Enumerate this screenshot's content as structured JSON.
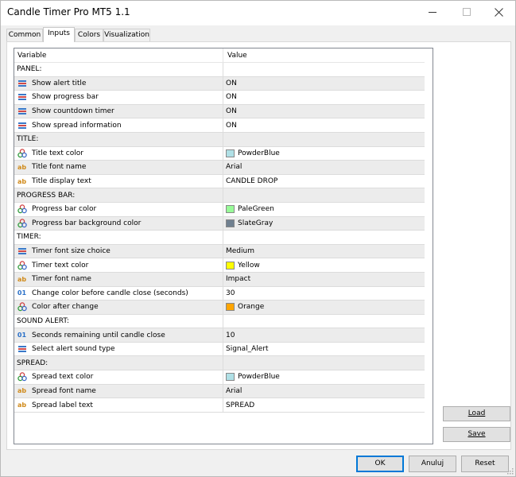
{
  "window": {
    "title": "Candle Timer Pro MT5 1.1"
  },
  "tabs": [
    {
      "label": "Common",
      "active": false
    },
    {
      "label": "Inputs",
      "active": true
    },
    {
      "label": "Colors",
      "active": false
    },
    {
      "label": "Visualization",
      "active": false
    }
  ],
  "grid": {
    "headers": {
      "variable": "Variable",
      "value": "Value"
    },
    "rows": [
      {
        "kind": "section",
        "label": "PANEL:"
      },
      {
        "kind": "bool",
        "icon": "enum-icon",
        "label": "Show alert title",
        "value": "ON"
      },
      {
        "kind": "bool",
        "icon": "enum-icon",
        "label": "Show progress bar",
        "value": "ON"
      },
      {
        "kind": "bool",
        "icon": "enum-icon",
        "label": "Show countdown timer",
        "value": "ON"
      },
      {
        "kind": "bool",
        "icon": "enum-icon",
        "label": "Show spread information",
        "value": "ON"
      },
      {
        "kind": "section",
        "label": "TITLE:"
      },
      {
        "kind": "color",
        "icon": "color-palette-icon",
        "label": "Title text color",
        "value": "PowderBlue",
        "color": "#b0e0e6"
      },
      {
        "kind": "text",
        "icon": "string-icon",
        "label": "Title font name",
        "value": "Arial"
      },
      {
        "kind": "text",
        "icon": "string-icon",
        "label": "Title display text",
        "value": "CANDLE DROP"
      },
      {
        "kind": "section",
        "label": "PROGRESS BAR:"
      },
      {
        "kind": "color",
        "icon": "color-palette-icon",
        "label": "Progress bar color",
        "value": "PaleGreen",
        "color": "#98fb98"
      },
      {
        "kind": "color",
        "icon": "color-palette-icon",
        "label": "Progress bar background color",
        "value": "SlateGray",
        "color": "#708090"
      },
      {
        "kind": "section",
        "label": "TIMER:"
      },
      {
        "kind": "enum",
        "icon": "enum-icon",
        "label": "Timer font size choice",
        "value": "Medium"
      },
      {
        "kind": "color",
        "icon": "color-palette-icon",
        "label": "Timer text color",
        "value": "Yellow",
        "color": "#ffff00"
      },
      {
        "kind": "text",
        "icon": "string-icon",
        "label": "Timer font name",
        "value": "Impact"
      },
      {
        "kind": "number",
        "icon": "integer-icon",
        "label": "Change color before candle close (seconds)",
        "value": "30"
      },
      {
        "kind": "color",
        "icon": "color-palette-icon",
        "label": "Color after change",
        "value": "Orange",
        "color": "#ffa500"
      },
      {
        "kind": "section",
        "label": "SOUND ALERT:"
      },
      {
        "kind": "number",
        "icon": "integer-icon",
        "label": "Seconds remaining until candle close",
        "value": "10"
      },
      {
        "kind": "enum",
        "icon": "enum-icon",
        "label": "Select alert sound type",
        "value": "Signal_Alert"
      },
      {
        "kind": "section",
        "label": "SPREAD:"
      },
      {
        "kind": "color",
        "icon": "color-palette-icon",
        "label": "Spread text color",
        "value": "PowderBlue",
        "color": "#b0e0e6"
      },
      {
        "kind": "text",
        "icon": "string-icon",
        "label": "Spread font name",
        "value": "Arial"
      },
      {
        "kind": "text",
        "icon": "string-icon",
        "label": "Spread label text",
        "value": "SPREAD"
      }
    ]
  },
  "side_buttons": {
    "load": "Load",
    "save": "Save"
  },
  "buttons": {
    "ok": "OK",
    "cancel": "Anuluj",
    "reset": "Reset"
  },
  "icons": {
    "enum": "enum-icon",
    "color": "color-palette-icon",
    "string": "string-icon",
    "integer": "integer-icon",
    "string_glyph": "ab",
    "integer_glyph": "01"
  }
}
